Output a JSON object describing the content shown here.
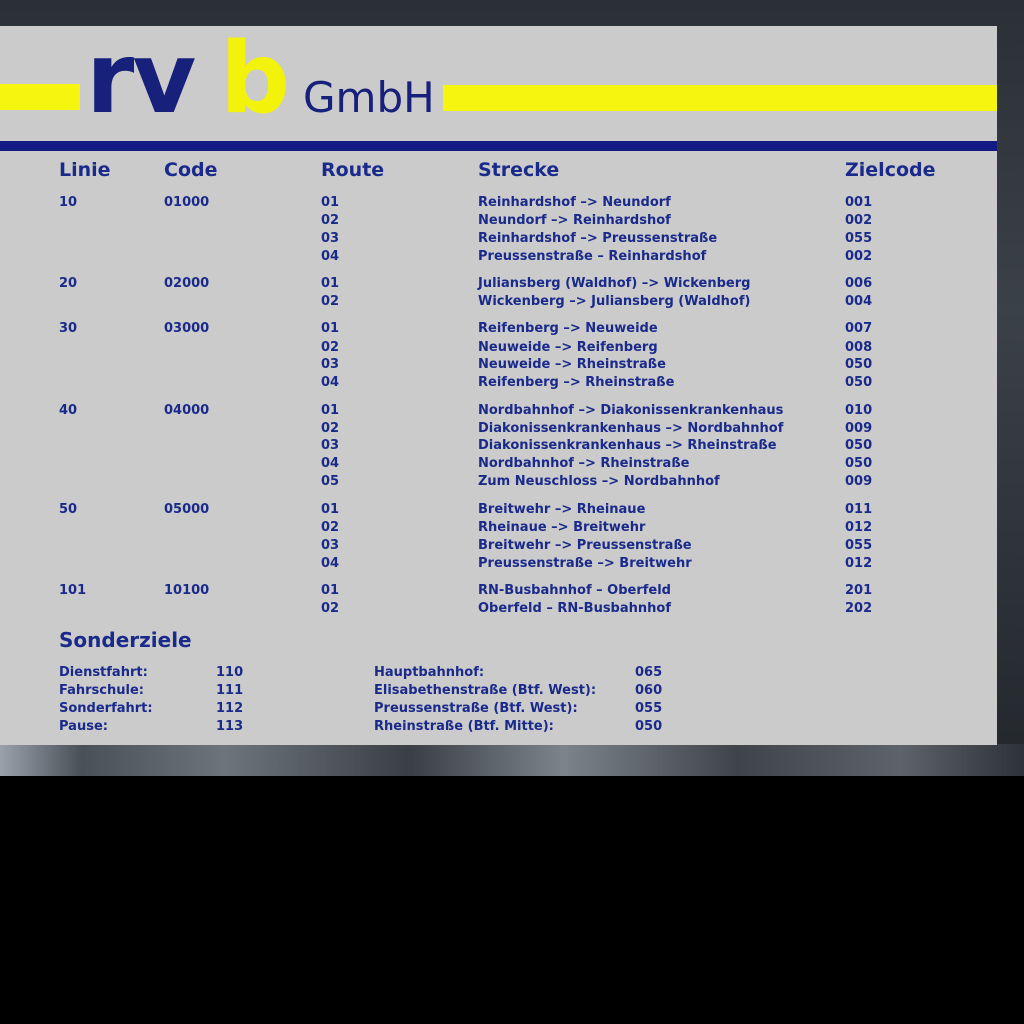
{
  "logo": {
    "rv": "rv",
    "b": "b",
    "company": "GmbH"
  },
  "headers": {
    "linie": "Linie",
    "code": "Code",
    "route": "Route",
    "strecke": "Strecke",
    "zielcode": "Zielcode"
  },
  "rows": [
    {
      "linie": "10",
      "code": "01000",
      "route": "01",
      "strecke": "Reinhardshof –> Neundorf",
      "ziel": "001"
    },
    {
      "linie": "",
      "code": "",
      "route": "02",
      "strecke": "Neundorf –> Reinhardshof",
      "ziel": "002"
    },
    {
      "linie": "",
      "code": "",
      "route": "03",
      "strecke": "Reinhardshof –> Preussenstraße",
      "ziel": "055"
    },
    {
      "linie": "",
      "code": "",
      "route": "04",
      "strecke": "Preussenstraße – Reinhardshof",
      "ziel": "002"
    },
    {
      "linie": "20",
      "code": "02000",
      "route": "01",
      "strecke": "Juliansberg (Waldhof) –> Wickenberg",
      "ziel": "006"
    },
    {
      "linie": "",
      "code": "",
      "route": "02",
      "strecke": "Wickenberg –> Juliansberg (Waldhof)",
      "ziel": "004"
    },
    {
      "linie": "30",
      "code": "03000",
      "route": "01",
      "strecke": "Reifenberg –> Neuweide",
      "ziel": "007"
    },
    {
      "linie": "",
      "code": "",
      "route": "02",
      "strecke": "Neuweide –> Reifenberg",
      "ziel": "008"
    },
    {
      "linie": "",
      "code": "",
      "route": "03",
      "strecke": "Neuweide –> Rheinstraße",
      "ziel": "050"
    },
    {
      "linie": "",
      "code": "",
      "route": "04",
      "strecke": "Reifenberg –> Rheinstraße",
      "ziel": "050"
    },
    {
      "linie": "40",
      "code": "04000",
      "route": "01",
      "strecke": "Nordbahnhof –> Diakonissenkrankenhaus",
      "ziel": "010"
    },
    {
      "linie": "",
      "code": "",
      "route": "02",
      "strecke": "Diakonissenkrankenhaus –> Nordbahnhof",
      "ziel": "009"
    },
    {
      "linie": "",
      "code": "",
      "route": "03",
      "strecke": "Diakonissenkrankenhaus –> Rheinstraße",
      "ziel": "050"
    },
    {
      "linie": "",
      "code": "",
      "route": "04",
      "strecke": "Nordbahnhof –> Rheinstraße",
      "ziel": "050"
    },
    {
      "linie": "",
      "code": "",
      "route": "05",
      "strecke": "Zum Neuschloss –> Nordbahnhof",
      "ziel": "009"
    },
    {
      "linie": "50",
      "code": "05000",
      "route": "01",
      "strecke": "Breitwehr –> Rheinaue",
      "ziel": "011"
    },
    {
      "linie": "",
      "code": "",
      "route": "02",
      "strecke": "Rheinaue –> Breitwehr",
      "ziel": "012"
    },
    {
      "linie": "",
      "code": "",
      "route": "03",
      "strecke": "Breitwehr –> Preussenstraße",
      "ziel": "055"
    },
    {
      "linie": "",
      "code": "",
      "route": "04",
      "strecke": "Preussenstraße –> Breitwehr",
      "ziel": "012"
    },
    {
      "linie": "101",
      "code": "10100",
      "route": "01",
      "strecke": "RN-Busbahnhof – Oberfeld",
      "ziel": "201"
    },
    {
      "linie": "",
      "code": "",
      "route": "02",
      "strecke": "Oberfeld – RN-Busbahnhof",
      "ziel": "202"
    }
  ],
  "sonderziele": {
    "title": "Sonderziele",
    "left": [
      {
        "label": "Dienstfahrt:",
        "code": "110"
      },
      {
        "label": "Fahrschule:",
        "code": "111"
      },
      {
        "label": "Sonderfahrt:",
        "code": "112"
      },
      {
        "label": "Pause:",
        "code": "113"
      }
    ],
    "right": [
      {
        "label": "Hauptbahnhof:",
        "code": "065"
      },
      {
        "label": "Elisabethenstraße (Btf. West):",
        "code": "060"
      },
      {
        "label": "Preussenstraße (Btf. West):",
        "code": "055"
      },
      {
        "label": "Rheinstraße (Btf. Mitte):",
        "code": "050"
      }
    ]
  },
  "colors": {
    "navy": "#1a2a8a",
    "yellow": "#f5f50f",
    "board": "#cbcbcb"
  }
}
